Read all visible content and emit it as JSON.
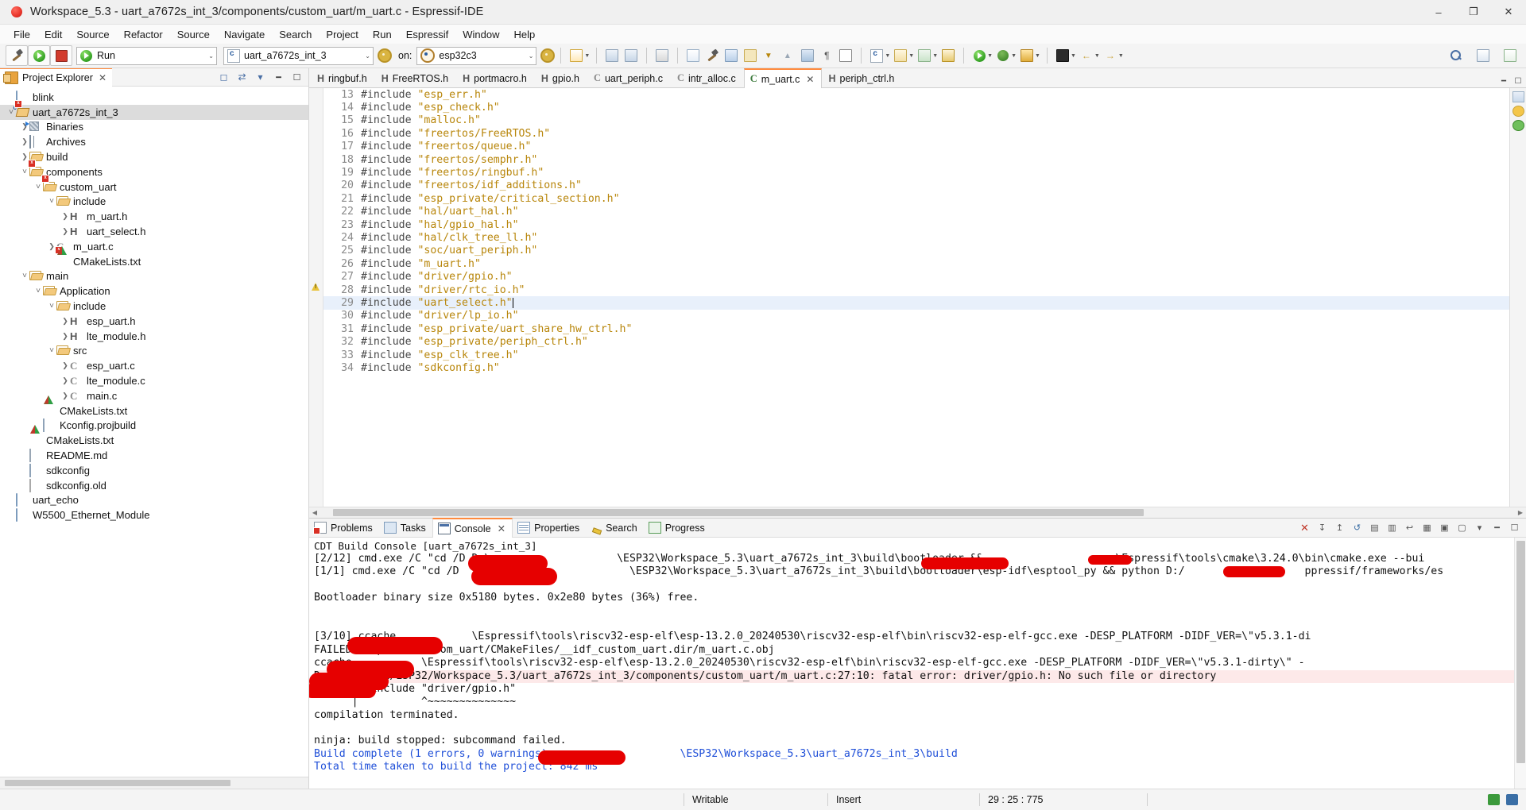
{
  "window": {
    "title": "Workspace_5.3 - uart_a7672s_int_3/components/custom_uart/m_uart.c - Espressif-IDE",
    "minimize": "–",
    "maximize": "❐",
    "close": "✕"
  },
  "menubar": {
    "items": [
      "File",
      "Edit",
      "Source",
      "Refactor",
      "Source",
      "Navigate",
      "Search",
      "Project",
      "Run",
      "Espressif",
      "Window",
      "Help"
    ]
  },
  "toolbar": {
    "launch_mode": "Run",
    "project_combo": "uart_a7672s_int_3",
    "on_label": "on:",
    "target_combo": "esp32c3",
    "caret": "⌄"
  },
  "project_explorer": {
    "title": "Project Explorer",
    "close": "✕",
    "tree": [
      {
        "label": "blink",
        "depth": 0,
        "twisty": "",
        "icon": "folder-blue"
      },
      {
        "label": "uart_a7672s_int_3",
        "depth": 0,
        "twisty": "open",
        "icon": "c-project",
        "selected": true
      },
      {
        "label": "Binaries",
        "depth": 1,
        "twisty": "closed",
        "icon": "binaries"
      },
      {
        "label": "Archives",
        "depth": 1,
        "twisty": "closed",
        "icon": "archives"
      },
      {
        "label": "build",
        "depth": 1,
        "twisty": "closed",
        "icon": "folder-open"
      },
      {
        "label": "components",
        "depth": 1,
        "twisty": "open",
        "icon": "folder-open-x"
      },
      {
        "label": "custom_uart",
        "depth": 2,
        "twisty": "open",
        "icon": "folder-open-x"
      },
      {
        "label": "include",
        "depth": 3,
        "twisty": "open",
        "icon": "folder-open"
      },
      {
        "label": "m_uart.h",
        "depth": 4,
        "twisty": "closed",
        "icon": "header"
      },
      {
        "label": "uart_select.h",
        "depth": 4,
        "twisty": "closed",
        "icon": "header"
      },
      {
        "label": "m_uart.c",
        "depth": 3,
        "twisty": "closed",
        "icon": "csrc-x"
      },
      {
        "label": "CMakeLists.txt",
        "depth": 3,
        "twisty": "",
        "icon": "cmake"
      },
      {
        "label": "main",
        "depth": 1,
        "twisty": "open",
        "icon": "folder-open"
      },
      {
        "label": "Application",
        "depth": 2,
        "twisty": "open",
        "icon": "folder-open"
      },
      {
        "label": "include",
        "depth": 3,
        "twisty": "open",
        "icon": "folder-open"
      },
      {
        "label": "esp_uart.h",
        "depth": 4,
        "twisty": "closed",
        "icon": "header"
      },
      {
        "label": "lte_module.h",
        "depth": 4,
        "twisty": "closed",
        "icon": "header"
      },
      {
        "label": "src",
        "depth": 3,
        "twisty": "open",
        "icon": "folder-open"
      },
      {
        "label": "esp_uart.c",
        "depth": 4,
        "twisty": "closed",
        "icon": "csrc"
      },
      {
        "label": "lte_module.c",
        "depth": 4,
        "twisty": "closed",
        "icon": "csrc"
      },
      {
        "label": "main.c",
        "depth": 4,
        "twisty": "closed",
        "icon": "csrc"
      },
      {
        "label": "CMakeLists.txt",
        "depth": 2,
        "twisty": "",
        "icon": "cmake"
      },
      {
        "label": "Kconfig.projbuild",
        "depth": 2,
        "twisty": "",
        "icon": "text"
      },
      {
        "label": "CMakeLists.txt",
        "depth": 1,
        "twisty": "",
        "icon": "cmake"
      },
      {
        "label": "README.md",
        "depth": 1,
        "twisty": "",
        "icon": "md"
      },
      {
        "label": "sdkconfig",
        "depth": 1,
        "twisty": "",
        "icon": "text"
      },
      {
        "label": "sdkconfig.old",
        "depth": 1,
        "twisty": "",
        "icon": "cfgold"
      },
      {
        "label": "uart_echo",
        "depth": 0,
        "twisty": "",
        "icon": "folder-blue"
      },
      {
        "label": "W5500_Ethernet_Module",
        "depth": 0,
        "twisty": "",
        "icon": "folder-blue"
      }
    ]
  },
  "editor": {
    "tabs": [
      {
        "label": "ringbuf.h",
        "kind": "H",
        "active": false
      },
      {
        "label": "FreeRTOS.h",
        "kind": "H",
        "active": false
      },
      {
        "label": "portmacro.h",
        "kind": "H",
        "active": false
      },
      {
        "label": "gpio.h",
        "kind": "H",
        "active": false
      },
      {
        "label": "uart_periph.c",
        "kind": "C",
        "active": false
      },
      {
        "label": "intr_alloc.c",
        "kind": "C",
        "active": false
      },
      {
        "label": "m_uart.c",
        "kind": "C",
        "active": true
      },
      {
        "label": "periph_ctrl.h",
        "kind": "H",
        "active": false
      }
    ],
    "close_glyph": "✕",
    "lines": [
      {
        "n": 13,
        "directive": "#include",
        "value": "\"esp_err.h\""
      },
      {
        "n": 14,
        "directive": "#include",
        "value": "\"esp_check.h\""
      },
      {
        "n": 15,
        "directive": "#include",
        "value": "\"malloc.h\""
      },
      {
        "n": 16,
        "directive": "#include",
        "value": "\"freertos/FreeRTOS.h\""
      },
      {
        "n": 17,
        "directive": "#include",
        "value": "\"freertos/queue.h\""
      },
      {
        "n": 18,
        "directive": "#include",
        "value": "\"freertos/semphr.h\""
      },
      {
        "n": 19,
        "directive": "#include",
        "value": "\"freertos/ringbuf.h\""
      },
      {
        "n": 20,
        "directive": "#include",
        "value": "\"freertos/idf_additions.h\""
      },
      {
        "n": 21,
        "directive": "#include",
        "value": "\"esp_private/critical_section.h\""
      },
      {
        "n": 22,
        "directive": "#include",
        "value": "\"hal/uart_hal.h\""
      },
      {
        "n": 23,
        "directive": "#include",
        "value": "\"hal/gpio_hal.h\""
      },
      {
        "n": 24,
        "directive": "#include",
        "value": "\"hal/clk_tree_ll.h\""
      },
      {
        "n": 25,
        "directive": "#include",
        "value": "\"soc/uart_periph.h\""
      },
      {
        "n": 26,
        "directive": "#include",
        "value": "\"m_uart.h\""
      },
      {
        "n": 27,
        "directive": "#include",
        "value": "\"driver/gpio.h\"",
        "marker": "warning"
      },
      {
        "n": 28,
        "directive": "#include",
        "value": "\"driver/rtc_io.h\""
      },
      {
        "n": 29,
        "directive": "#include",
        "value": "\"uart_select.h\"",
        "highlight": true,
        "caret": true
      },
      {
        "n": 30,
        "directive": "#include",
        "value": "\"driver/lp_io.h\""
      },
      {
        "n": 31,
        "directive": "#include",
        "value": "\"esp_private/uart_share_hw_ctrl.h\""
      },
      {
        "n": 32,
        "directive": "#include",
        "value": "\"esp_private/periph_ctrl.h\""
      },
      {
        "n": 33,
        "directive": "#include",
        "value": "\"esp_clk_tree.h\""
      },
      {
        "n": 34,
        "directive": "#include",
        "value": "\"sdkconfig.h\""
      }
    ]
  },
  "console": {
    "tabs": [
      {
        "label": "Problems",
        "icon": "problems",
        "active": false
      },
      {
        "label": "Tasks",
        "icon": "tasks",
        "active": false
      },
      {
        "label": "Console",
        "icon": "console",
        "active": true
      },
      {
        "label": "Properties",
        "icon": "props",
        "active": false
      },
      {
        "label": "Search",
        "icon": "search",
        "active": false
      },
      {
        "label": "Progress",
        "icon": "progress",
        "active": false
      }
    ],
    "close_glyph": "✕",
    "title": "CDT Build Console [uart_a7672s_int_3]",
    "lines": [
      {
        "text": "[2/12] cmd.exe /C \"cd /D D:\\                    \\ESP32\\Workspace_5.3\\uart_a7672s_int_3\\build\\bootloader &&                     \\Espressif\\tools\\cmake\\3.24.0\\bin\\cmake.exe --bui"
      },
      {
        "text": "[1/1] cmd.exe /C \"cd /D                           \\ESP32\\Workspace_5.3\\uart_a7672s_int_3\\build\\bootloader\\esp-idf\\esptool_py && python D:/                   ppressif/frameworks/es"
      },
      {
        "text": ""
      },
      {
        "text": "Bootloader binary size 0x5180 bytes. 0x2e80 bytes (36%) free."
      },
      {
        "text": ""
      },
      {
        "text": ""
      },
      {
        "text": "[3/10] ccache            \\Espressif\\tools\\riscv32-esp-elf\\esp-13.2.0_20240530\\riscv32-esp-elf\\bin\\riscv32-esp-elf-gcc.exe -DESP_PLATFORM -DIDF_VER=\\\"v5.3.1-di"
      },
      {
        "text": "FAILED: esp-idf/custom_uart/CMakeFiles/__idf_custom_uart.dir/m_uart.c.obj"
      },
      {
        "text": "ccache           \\Espressif\\tools\\riscv32-esp-elf\\esp-13.2.0_20240530\\riscv32-esp-elf\\bin\\riscv32-esp-elf-gcc.exe -DESP_PLATFORM -DIDF_VER=\\\"v5.3.1-dirty\\\" -"
      },
      {
        "text": "D:/xxxx/xxxx/ESP32/Workspace_5.3/uart_a7672s_int_3/components/custom_uart/m_uart.c:27:10: fatal error: driver/gpio.h: No such file or directory",
        "error": true
      },
      {
        "text": "   27 | #include \"driver/gpio.h\""
      },
      {
        "text": "      |          ^~~~~~~~~~~~~~~"
      },
      {
        "text": "compilation terminated."
      },
      {
        "text": ""
      },
      {
        "text": "ninja: build stopped: subcommand failed."
      },
      {
        "text": "Build complete (1 errors, 0 warnings):                    \\ESP32\\Workspace_5.3\\uart_a7672s_int_3\\build",
        "blue": true
      },
      {
        "text": "Total time taken to build the project: 842 ms",
        "blue": true
      }
    ]
  },
  "statusbar": {
    "writable": "Writable",
    "insert_mode": "Insert",
    "position": "29 : 25 : 775"
  },
  "colors": {
    "accent_orange": "#ff8a3d",
    "string_amber": "#b8860b",
    "error_bg": "#fde9e9",
    "link_blue": "#1f4fd8",
    "redaction_red": "#e60000",
    "selection_gray": "#dcdcdc"
  }
}
